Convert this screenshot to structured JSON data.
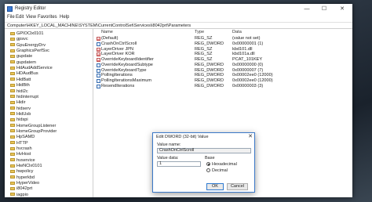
{
  "window": {
    "title": "Registry Editor",
    "controls": {
      "minimize": "—",
      "maximize": "☐",
      "close": "✕"
    }
  },
  "menu": [
    "File",
    "Edit",
    "View",
    "Favorites",
    "Help"
  ],
  "address": "Computer\\HKEY_LOCAL_MACHINE\\SYSTEM\\CurrentControlSet\\Services\\i8042prt\\Parameters",
  "tree": [
    "GPIOClx0101",
    "gpsvc",
    "GpuEnergyDrv",
    "GraphicsPerfSvc",
    "gupdate",
    "gupdatem",
    "HdAudAddService",
    "HDAudBus",
    "HidBatt",
    "HidBth",
    "hidi2c",
    "hidinterrupt",
    "Hidir",
    "hidserv",
    "HidUsb",
    "hidspi",
    "HomeGroupListener",
    "HomeGroupProvider",
    "HpSAMD",
    "HTTP",
    "hvcrash",
    "HvHost",
    "hvservice",
    "HwNClx0101",
    "hwpolicy",
    "hyperkbd",
    "HyperVideo",
    "i8042prt",
    "iagpio"
  ],
  "columns": {
    "name": "Name",
    "type": "Type",
    "data": "Data"
  },
  "values": [
    {
      "name": "(Default)",
      "type": "REG_SZ",
      "data": "(value not set)",
      "icon": "ab"
    },
    {
      "name": "CrashOnCtrlScroll",
      "type": "REG_DWORD",
      "data": "0x00000001 (1)",
      "icon": "bin"
    },
    {
      "name": "LayerDriver JPN",
      "type": "REG_SZ",
      "data": "kbd101.dll",
      "icon": "ab"
    },
    {
      "name": "LayerDriver KOR",
      "type": "REG_SZ",
      "data": "kbd101a.dll",
      "icon": "ab"
    },
    {
      "name": "OverrideKeyboardIdentifier",
      "type": "REG_SZ",
      "data": "PCAT_101KEY",
      "icon": "ab"
    },
    {
      "name": "OverrideKeyboardSubtype",
      "type": "REG_DWORD",
      "data": "0x00000000 (0)",
      "icon": "bin"
    },
    {
      "name": "OverrideKeyboardType",
      "type": "REG_DWORD",
      "data": "0x00000007 (7)",
      "icon": "bin"
    },
    {
      "name": "PollingIterations",
      "type": "REG_DWORD",
      "data": "0x00002ee0 (12000)",
      "icon": "bin"
    },
    {
      "name": "PollingIterationsMaximum",
      "type": "REG_DWORD",
      "data": "0x00002ee0 (12000)",
      "icon": "bin"
    },
    {
      "name": "ResendIterations",
      "type": "REG_DWORD",
      "data": "0x00000003 (3)",
      "icon": "bin"
    }
  ],
  "dialog": {
    "title": "Edit DWORD (32-bit) Value",
    "close": "✕",
    "value_name_label": "Value name:",
    "value_name": "CrashOnCtrlScroll",
    "value_data_label": "Value data:",
    "value_data": "1",
    "base_label": "Base",
    "hex_label": "Hexadecimal",
    "dec_label": "Decimal",
    "ok": "OK",
    "cancel": "Cancel"
  }
}
